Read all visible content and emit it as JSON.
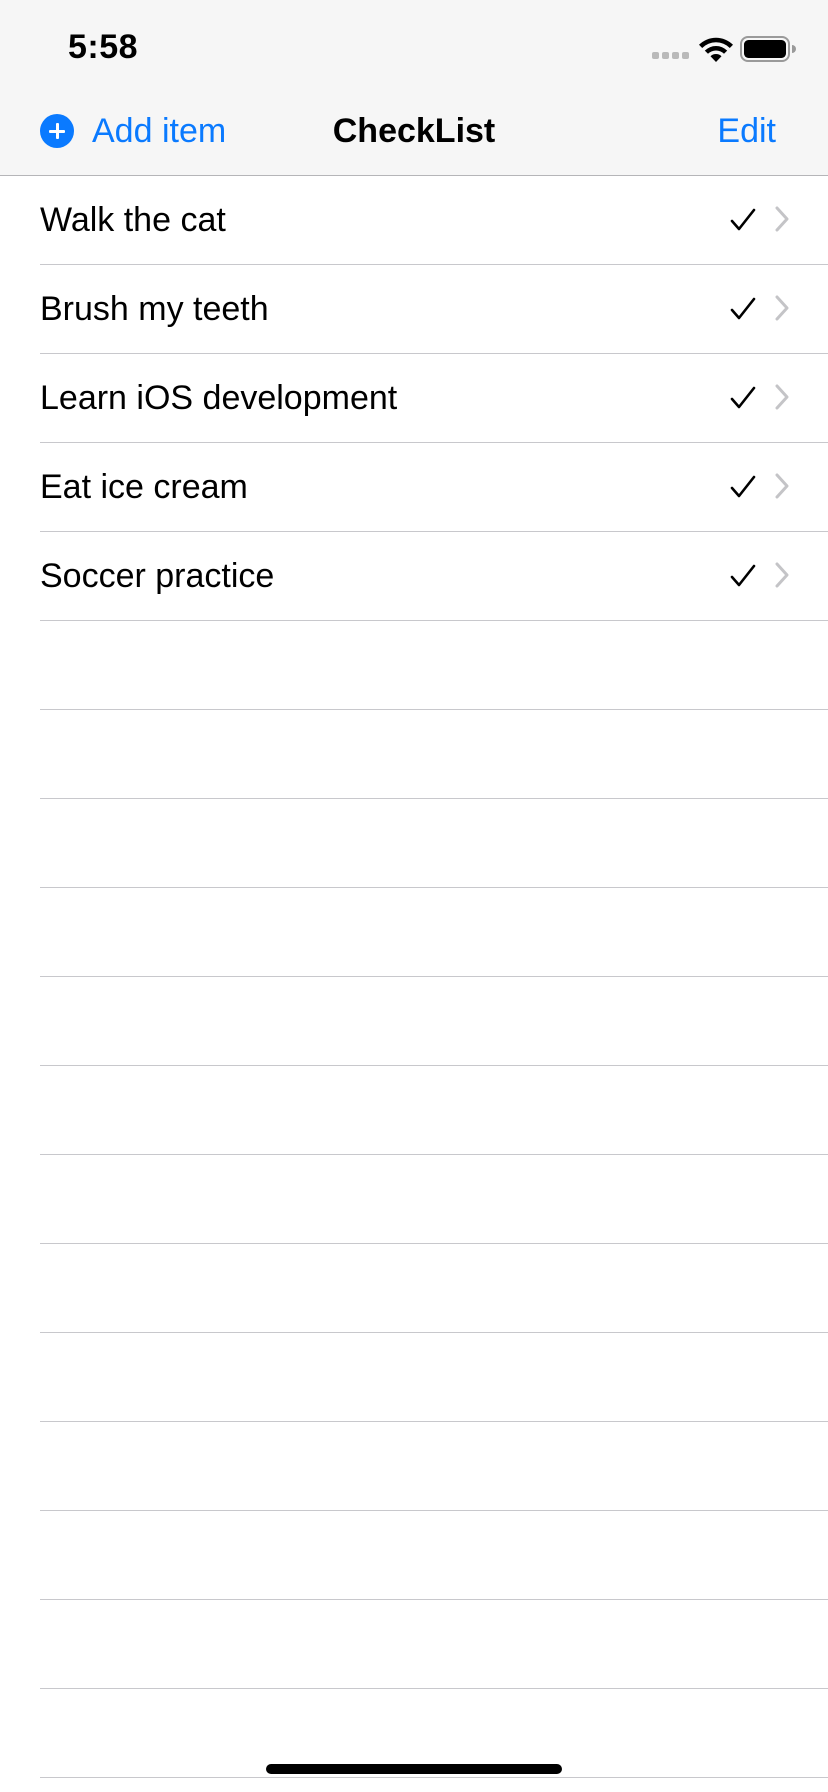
{
  "status_bar": {
    "time": "5:58",
    "icons": [
      "signal-icon",
      "wifi-icon",
      "battery-icon"
    ]
  },
  "nav": {
    "add_label": "Add item",
    "add_icon": "plus-circle-icon",
    "title": "CheckList",
    "edit_label": "Edit"
  },
  "colors": {
    "accent": "#0a7aff",
    "bar_background": "#f6f6f6",
    "separator": "#c8c8cc",
    "chevron": "#c4c4c7"
  },
  "items": [
    {
      "label": "Walk the cat",
      "checked": true
    },
    {
      "label": "Brush my teeth",
      "checked": true
    },
    {
      "label": "Learn iOS development",
      "checked": true
    },
    {
      "label": "Eat ice cream",
      "checked": true
    },
    {
      "label": "Soccer practice",
      "checked": true
    }
  ]
}
